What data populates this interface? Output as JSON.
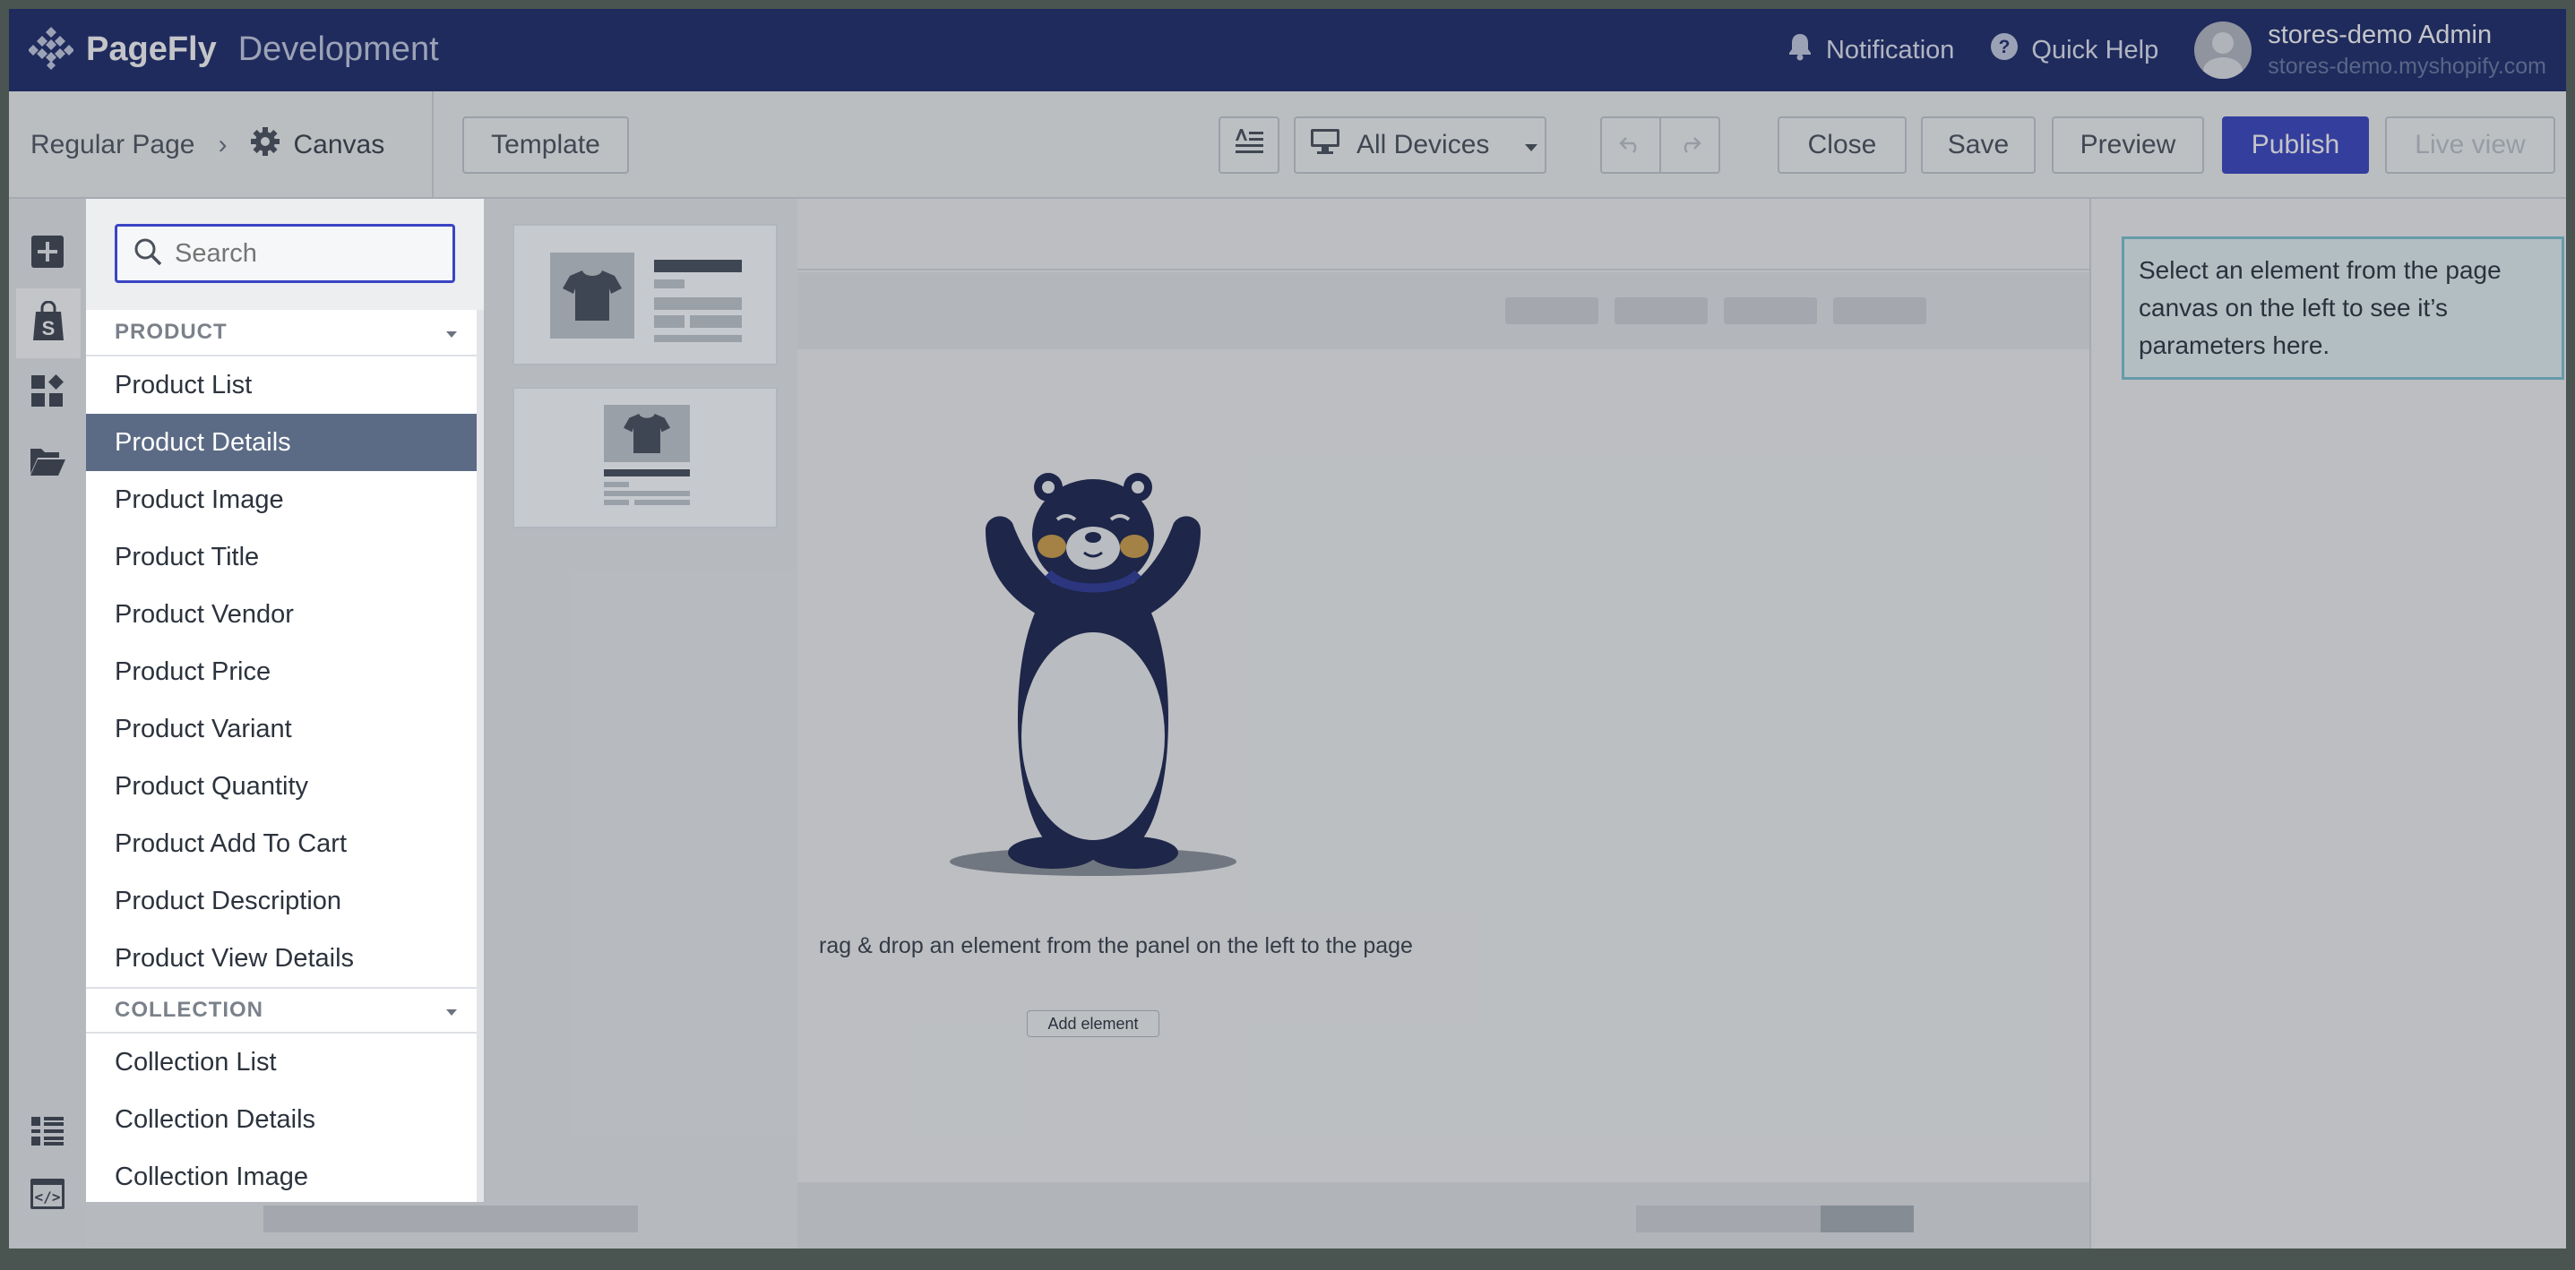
{
  "app": {
    "brand": "PageFly",
    "environment": "Development"
  },
  "topnav": {
    "notification_label": "Notification",
    "help_label": "Quick Help",
    "user_name": "stores-demo Admin",
    "user_domain": "stores-demo.myshopify.com"
  },
  "toolbar": {
    "breadcrumb_page": "Regular Page",
    "breadcrumb_canvas": "Canvas",
    "template_label": "Template",
    "devices_label": "All Devices",
    "close_label": "Close",
    "save_label": "Save",
    "preview_label": "Preview",
    "publish_label": "Publish",
    "liveview_label": "Live view"
  },
  "panel": {
    "search_placeholder": "Search",
    "product_category": "PRODUCT",
    "product_items": [
      "Product List",
      "Product Details",
      "Product Image",
      "Product Title",
      "Product Vendor",
      "Product Price",
      "Product Variant",
      "Product Quantity",
      "Product Add To Cart",
      "Product Description",
      "Product View Details"
    ],
    "selected_item": "Product Details",
    "collection_category": "COLLECTION",
    "collection_items": [
      "Collection List",
      "Collection Details",
      "Collection Image"
    ]
  },
  "canvas": {
    "hint": "rag & drop an element from the panel on the left to the page",
    "add_element": "Add element"
  },
  "rightpanel": {
    "info": "Select an element from the page canvas on the left to see it’s parameters here."
  },
  "colors": {
    "nav_bg": "#1d2a6b",
    "accent": "#3a44c4",
    "selected_item": "#5c6b85",
    "bear": "#1b2350",
    "info_border": "#7fc5d6"
  }
}
